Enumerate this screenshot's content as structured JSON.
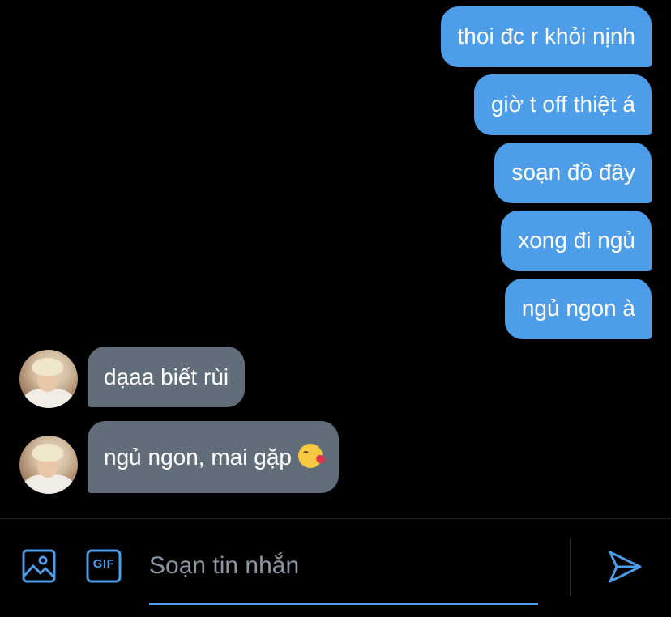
{
  "messages": {
    "outgoing": [
      {
        "text": "thoi đc r khỏi nịnh"
      },
      {
        "text": "giờ t off thiệt á"
      },
      {
        "text": "soạn đồ đây"
      },
      {
        "text": "xong đi ngủ"
      },
      {
        "text": "ngủ ngon à"
      }
    ],
    "incoming": [
      {
        "text": "dạaa biết rùi"
      },
      {
        "text": "ngủ ngon, mai gặp",
        "emoji": "kissing-face-with-heart-emoji"
      }
    ]
  },
  "composer": {
    "placeholder": "Soạn tin nhắn",
    "gif_label": "GIF",
    "icons": [
      "image-icon",
      "gif-icon",
      "send-icon"
    ]
  },
  "colors": {
    "outgoing_bubble": "#4d9de9",
    "incoming_bubble": "#616d79",
    "accent": "#4d9de9",
    "background": "#000000"
  }
}
